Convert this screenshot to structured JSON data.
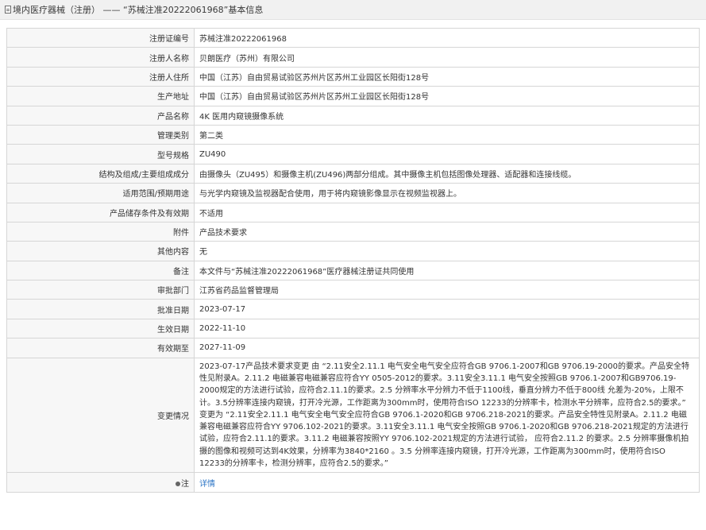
{
  "header": {
    "title": "境内医疗器械（注册） —— “苏械注准20222061968”基本信息"
  },
  "rows": [
    {
      "label": "注册证编号",
      "value": "苏械注准20222061968"
    },
    {
      "label": "注册人名称",
      "value": "贝朗医疗（苏州）有限公司"
    },
    {
      "label": "注册人住所",
      "value": "中国（江苏）自由贸易试验区苏州片区苏州工业园区长阳街128号"
    },
    {
      "label": "生产地址",
      "value": "中国（江苏）自由贸易试验区苏州片区苏州工业园区长阳街128号"
    },
    {
      "label": "产品名称",
      "value": "4K 医用内窥镜摄像系统"
    },
    {
      "label": "管理类别",
      "value": "第二类"
    },
    {
      "label": "型号规格",
      "value": "ZU490"
    },
    {
      "label": "结构及组成/主要组成成分",
      "value": "由摄像头（ZU495）和摄像主机(ZU496)两部分组成。其中摄像主机包括图像处理器、适配器和连接线缆。"
    },
    {
      "label": "适用范围/预期用途",
      "value": "与光学内窥镜及监视器配合使用，用于将内窥镜影像显示在视频监视器上。"
    },
    {
      "label": "产品储存条件及有效期",
      "value": "不适用"
    },
    {
      "label": "附件",
      "value": "产品技术要求"
    },
    {
      "label": "其他内容",
      "value": "无"
    },
    {
      "label": "备注",
      "value": "本文件与“苏械注准20222061968”医疗器械注册证共同使用"
    },
    {
      "label": "审批部门",
      "value": "江苏省药品监督管理局"
    },
    {
      "label": "批准日期",
      "value": "2023-07-17"
    },
    {
      "label": "生效日期",
      "value": "2022-11-10"
    },
    {
      "label": "有效期至",
      "value": "2027-11-09"
    }
  ],
  "changes": {
    "label": "变更情况",
    "value": "2023-07-17产品技术要求变更 由 “2.11安全2.11.1 电气安全电气安全应符合GB 9706.1-2007和GB 9706.19-2000的要求。产品安全特性见附录A。2.11.2 电磁兼容电磁兼容应符合YY 0505-2012的要求。3.11安全3.11.1 电气安全按照GB 9706.1-2007和GB9706.19-2000规定的方法进行试验，应符合2.11.1的要求。2.5 分辨率水平分辨力不低于1100线，垂直分辨力不低于800线 允差为-20%，上限不计。3.5分辨率连接内窥镜，打开冷光源，工作距离为300mm时，使用符合ISO 12233的分辨率卡，检测水平分辨率，应符合2.5的要求。” 变更为 “2.11安全2.11.1 电气安全电气安全应符合GB 9706.1-2020和GB 9706.218-2021的要求。产品安全特性见附录A。2.11.2 电磁兼容电磁兼容应符合YY 9706.102-2021的要求。3.11安全3.11.1 电气安全按照GB 9706.1-2020和GB 9706.218-2021规定的方法进行试验，应符合2.11.1的要求。3.11.2 电磁兼容按照YY 9706.102-2021规定的方法进行试验， 应符合2.11.2 的要求。2.5 分辨率摄像机拍摄的图像和视频可达到4K效果，分辨率为3840*2160 。3.5 分辨率连接内窥镜，打开冷光源，工作距离为300mm时，使用符合ISO 12233的分辨率卡，检测分辨率，应符合2.5的要求。”"
  },
  "note": {
    "label": "注",
    "link_text": "详情",
    "link_color": "#2d76c6"
  }
}
